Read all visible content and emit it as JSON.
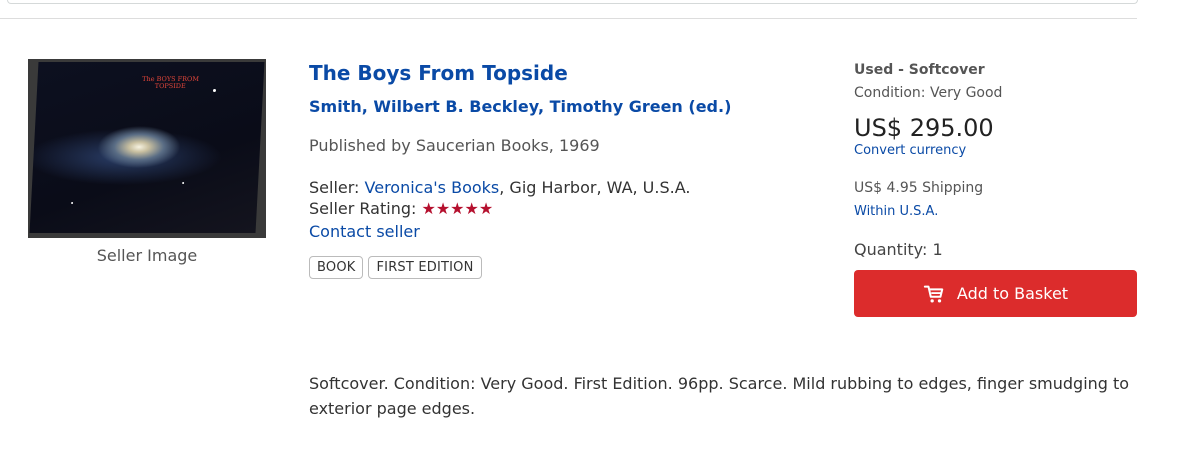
{
  "listing": {
    "image_caption": "Seller Image",
    "cover_title": "The BOYS FROM TOPSIDE",
    "title": "The Boys From Topside",
    "author": "Smith, Wilbert B. Beckley, Timothy Green (ed.)",
    "publisher": "Published by Saucerian Books, 1969",
    "seller_prefix": "Seller: ",
    "seller_name": "Veronica's Books",
    "seller_location": ", Gig Harbor, WA, U.S.A.",
    "rating_label": "Seller Rating: ",
    "rating_stars": "★★★★★",
    "contact_label": "Contact seller",
    "tags": [
      "BOOK",
      "FIRST EDITION"
    ],
    "description": "Softcover. Condition: Very Good. First Edition. 96pp. Scarce. Mild rubbing to edges, finger smudging to exterior page edges."
  },
  "purchase": {
    "binding": "Used - Softcover",
    "condition": "Condition: Very Good",
    "price": "US$ 295.00",
    "convert_label": "Convert currency",
    "shipping": "US$ 4.95 Shipping",
    "shipping_destination": "Within U.S.A.",
    "quantity": "Quantity: 1",
    "add_button_label": "Add to Basket",
    "button_icon": "cart-icon"
  },
  "colors": {
    "link": "#0a4aa6",
    "button": "#dc2c2c",
    "stars": "#b5102e"
  }
}
